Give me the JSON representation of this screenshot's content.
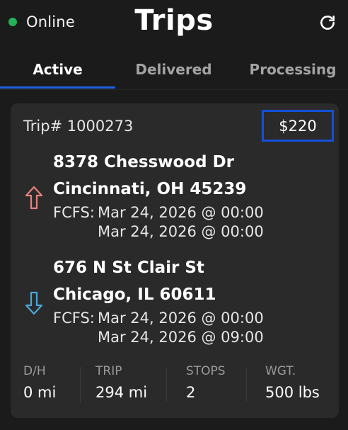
{
  "header": {
    "status": "Online",
    "title": "Trips",
    "status_color": "#22b357",
    "refresh_icon": "refresh-icon"
  },
  "tabs": [
    {
      "label": "Active",
      "active": true
    },
    {
      "label": "Delivered",
      "active": false
    },
    {
      "label": "Processing",
      "active": false
    }
  ],
  "accent_color": "#1e5fe0",
  "trip": {
    "number_label": "Trip# 1000273",
    "price": "$220",
    "pickup": {
      "address_line1": "8378 Chesswood Dr",
      "address_line2": "Cincinnati, OH 45239",
      "schedule_label": "FCFS:",
      "start": "Mar 24, 2026 @ 00:00",
      "end": "Mar 24, 2026 @ 00:00",
      "icon": "arrow-up-icon",
      "icon_color": "#e8827c"
    },
    "dropoff": {
      "address_line1": "676 N St Clair St",
      "address_line2": "Chicago, IL 60611",
      "schedule_label": "FCFS:",
      "start": "Mar 24, 2026 @ 00:00",
      "end": "Mar 24, 2026 @ 09:00",
      "icon": "arrow-down-icon",
      "icon_color": "#4aa8d8"
    },
    "stats": [
      {
        "label": "D/H",
        "value": "0 mi"
      },
      {
        "label": "TRIP",
        "value": "294 mi"
      },
      {
        "label": "STOPS",
        "value": "2"
      },
      {
        "label": "WGT.",
        "value": "500 lbs"
      }
    ]
  }
}
